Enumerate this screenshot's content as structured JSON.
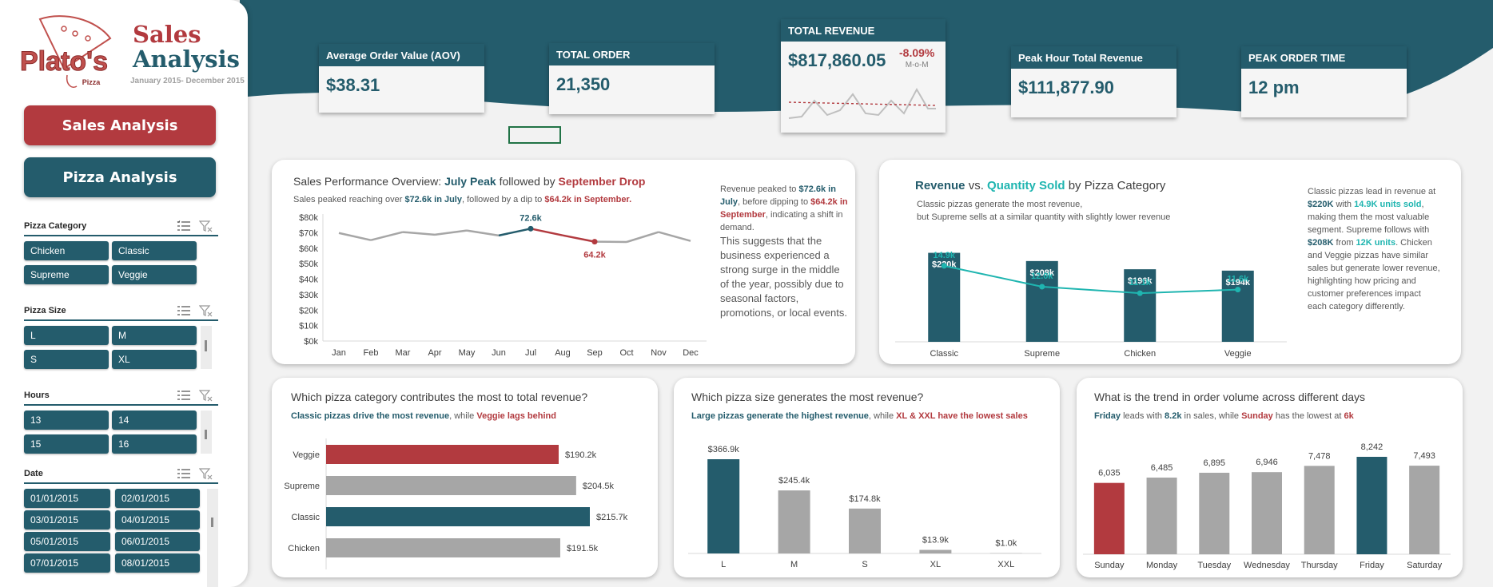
{
  "brand": {
    "logo_text": "Plato's",
    "logo_sub": "Pizza",
    "title_line1": "Sales",
    "title_line2": "Analysis",
    "date_range": "January 2015- December 2015"
  },
  "nav": {
    "sales_label": "Sales Analysis",
    "pizza_label": "Pizza Analysis"
  },
  "slicers": {
    "category": {
      "title": "Pizza Category",
      "items": [
        "Chicken",
        "Classic",
        "Supreme",
        "Veggie"
      ]
    },
    "size": {
      "title": "Pizza Size",
      "items": [
        "L",
        "M",
        "S",
        "XL"
      ]
    },
    "hours": {
      "title": "Hours",
      "items": [
        "13",
        "14",
        "15",
        "16"
      ]
    },
    "date": {
      "title": "Date",
      "items": [
        "01/01/2015",
        "02/01/2015",
        "03/01/2015",
        "04/01/2015",
        "05/01/2015",
        "06/01/2015",
        "07/01/2015",
        "08/01/2015"
      ]
    }
  },
  "kpis": {
    "aov": {
      "label": "Average Order Value (AOV)",
      "value": "$38.31"
    },
    "orders": {
      "label": "TOTAL ORDER",
      "value": "21,350"
    },
    "revenue": {
      "label": "TOTAL REVENUE",
      "value": "$817,860.05",
      "change": "-8.09%",
      "change_label": "M-o-M"
    },
    "peak_rev": {
      "label": "Peak Hour Total Revenue",
      "value": "$111,877.90"
    },
    "peak_time": {
      "label": "PEAK ORDER TIME",
      "value": "12 pm"
    }
  },
  "panels": {
    "monthly": {
      "title_pre": "Sales Performance Overview: ",
      "title_peak": "July Peak",
      "title_mid": " followed by ",
      "title_drop": "September Drop",
      "sub_pre": "Sales peaked reaching over ",
      "sub_peak": "$72.6k in July",
      "sub_mid": ", followed by a dip to ",
      "sub_drop": "$64.2k in September.",
      "narr_a": "Revenue peaked to ",
      "narr_b": "$72.6k in July",
      "narr_c": ", before dipping to ",
      "narr_d": "$64.2k in September",
      "narr_e": ", indicating a shift in demand.",
      "narr_f": "This suggests that the business experienced a strong surge in the middle of the year, possibly due to seasonal factors, promotions, or local events."
    },
    "category": {
      "title_a": "Revenue",
      "title_b": " vs. ",
      "title_c": "Quantity Sold",
      "title_d": " by Pizza Category",
      "sub1": "Classic pizzas generate the most revenue,",
      "sub2": "but Supreme sells at a similar quantity with slightly lower revenue",
      "narr_a": "Classic pizzas lead in revenue at ",
      "narr_b": "$220K",
      "narr_c": " with ",
      "narr_d": "14.9K units sold",
      "narr_e": ", making them the most valuable segment. Supreme follows with ",
      "narr_f": "$208K",
      "narr_g": " from ",
      "narr_h": "12K units",
      "narr_i": ". Chicken and Veggie pizzas have similar sales but generate lower revenue, highlighting how pricing and customer preferences impact each category differently."
    },
    "cat_rev": {
      "title": "Which pizza category contributes the most to total revenue?",
      "sub_a": "Classic pizzas drive the most revenue",
      "sub_b": ", while ",
      "sub_c": "Veggie lags behind"
    },
    "size_rev": {
      "title": "Which pizza size generates the most revenue?",
      "sub_a": "Large pizzas generate the highest revenue",
      "sub_b": ", while ",
      "sub_c": "XL  & XXL have the lowest sales"
    },
    "days": {
      "title": "What is the trend in order volume across different days",
      "sub_a": "Friday",
      "sub_b": " leads with ",
      "sub_c": "8.2k",
      "sub_d": " in sales, while ",
      "sub_e": "Sunday",
      "sub_f": " has the lowest at ",
      "sub_g": "6k"
    }
  },
  "colors": {
    "teal": "#245c6c",
    "red": "#b23a3f",
    "cyan": "#1fb5b0",
    "gray": "#a6a6a6"
  },
  "chart_data": [
    {
      "type": "line",
      "categories": [
        "Jan",
        "Feb",
        "Mar",
        "Apr",
        "May",
        "Jun",
        "Jul",
        "Aug",
        "Sep",
        "Oct",
        "Nov",
        "Dec"
      ],
      "values": [
        69.8,
        65.2,
        70.4,
        68.7,
        71.4,
        68.2,
        72.6,
        68.3,
        64.2,
        64.0,
        70.4,
        64.7
      ],
      "yticks": [
        "$0k",
        "$10k",
        "$20k",
        "$30k",
        "$40k",
        "$50k",
        "$60k",
        "$70k",
        "$80k"
      ],
      "ylim": [
        0,
        80
      ],
      "annotations": {
        "peak": "72.6k",
        "drop": "64.2k"
      }
    },
    {
      "type": "bar",
      "categories": [
        "Classic",
        "Supreme",
        "Chicken",
        "Veggie"
      ],
      "series": [
        {
          "values": [
            220,
            208,
            196,
            194
          ],
          "labels": [
            "$220k",
            "$208k",
            "$196k",
            "$194k"
          ]
        },
        {
          "values": [
            14.9,
            12.0,
            11.1,
            11.6
          ],
          "labels": [
            "14.9k",
            "12.0k",
            "11.1k",
            "11.6k"
          ]
        }
      ]
    },
    {
      "type": "bar",
      "orientation": "horizontal",
      "categories": [
        "Veggie",
        "Supreme",
        "Classic",
        "Chicken"
      ],
      "values": [
        190.2,
        204.5,
        215.7,
        191.5
      ],
      "labels": [
        "$190.2k",
        "$204.5k",
        "$215.7k",
        "$191.5k"
      ]
    },
    {
      "type": "bar",
      "categories": [
        "L",
        "M",
        "S",
        "XL",
        "XXL"
      ],
      "values": [
        366.9,
        245.4,
        174.8,
        13.9,
        1.0
      ],
      "labels": [
        "$366.9k",
        "$245.4k",
        "$174.8k",
        "$13.9k",
        "$1.0k"
      ]
    },
    {
      "type": "bar",
      "categories": [
        "Sunday",
        "Monday",
        "Tuesday",
        "Wednesday",
        "Thursday",
        "Friday",
        "Saturday"
      ],
      "values": [
        6035,
        6485,
        6895,
        6946,
        7478,
        8242,
        7493
      ],
      "labels": [
        "6,035",
        "6,485",
        "6,895",
        "6,946",
        "7,478",
        "8,242",
        "7,493"
      ]
    }
  ]
}
